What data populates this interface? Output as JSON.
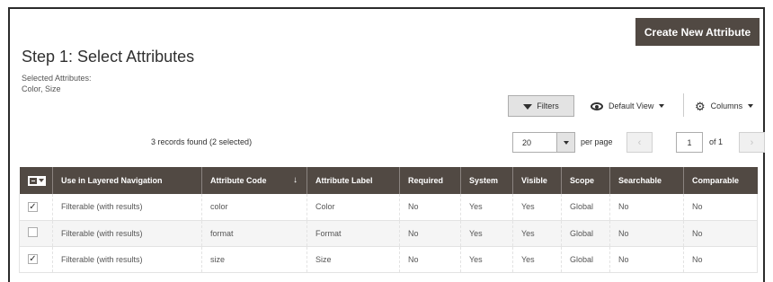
{
  "header": {
    "create_button": "Create New Attribute",
    "step_title": "Step 1: Select Attributes",
    "selected_label": "Selected Attributes:",
    "selected_values": "Color, Size"
  },
  "toolbar": {
    "filters_label": "Filters",
    "view_label": "Default View",
    "columns_label": "Columns",
    "records_text": "3 records found (2 selected)",
    "per_page_value": "20",
    "per_page_label": "per page",
    "page_current": "1",
    "page_of": "of 1",
    "prev_symbol": "‹",
    "next_symbol": "›",
    "icons": [
      "filter-icon",
      "eye-icon",
      "chevron-down-icon",
      "gear-icon"
    ]
  },
  "table": {
    "sort_mark": "↓",
    "columns": [
      "",
      "Use in Layered Navigation",
      "Attribute Code",
      "Attribute Label",
      "Required",
      "System",
      "Visible",
      "Scope",
      "Searchable",
      "Comparable"
    ],
    "rows": [
      {
        "checked": "✓",
        "nav": "Filterable (with results)",
        "code": "color",
        "label": "Color",
        "required": "No",
        "system": "Yes",
        "visible": "Yes",
        "scope": "Global",
        "searchable": "No",
        "comparable": "No"
      },
      {
        "checked": "",
        "nav": "Filterable (with results)",
        "code": "format",
        "label": "Format",
        "required": "No",
        "system": "Yes",
        "visible": "Yes",
        "scope": "Global",
        "searchable": "No",
        "comparable": "No"
      },
      {
        "checked": "✓",
        "nav": "Filterable (with results)",
        "code": "size",
        "label": "Size",
        "required": "No",
        "system": "Yes",
        "visible": "Yes",
        "scope": "Global",
        "searchable": "No",
        "comparable": "No"
      }
    ]
  },
  "colors": {
    "header_bg": "#514943",
    "button_bg": "#514943",
    "alt_row": "#f5f5f5"
  }
}
